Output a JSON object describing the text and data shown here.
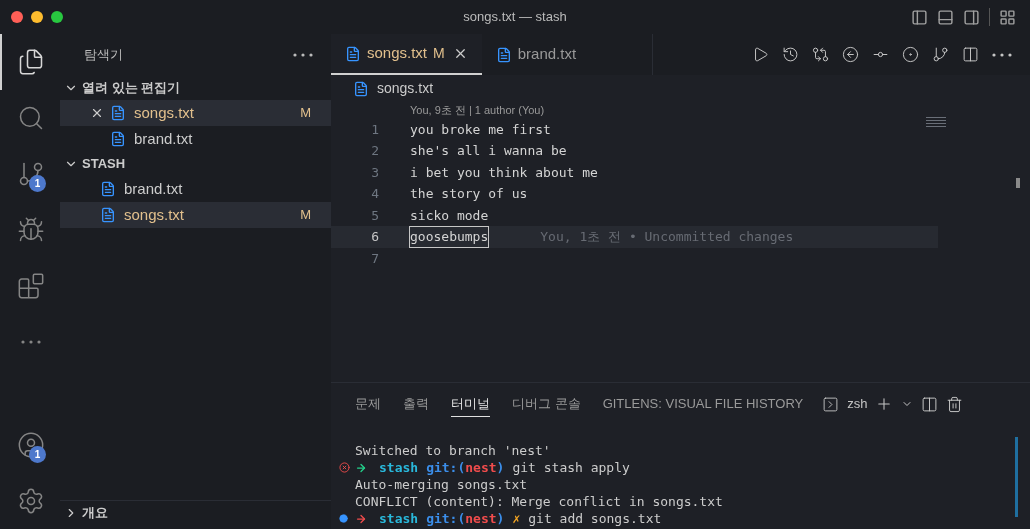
{
  "window": {
    "title": "songs.txt — stash"
  },
  "activity_bar": [
    {
      "kind": "files",
      "selected": true
    },
    {
      "kind": "search",
      "selected": false
    },
    {
      "kind": "source-control",
      "selected": false,
      "badge": "1"
    },
    {
      "kind": "debug",
      "selected": false
    },
    {
      "kind": "extensions",
      "selected": false
    },
    {
      "kind": "more",
      "selected": false
    }
  ],
  "activity_bar_bottom": [
    {
      "kind": "account",
      "badge": "1"
    },
    {
      "kind": "settings"
    }
  ],
  "sidebar": {
    "title": "탐색기",
    "sections": [
      {
        "title": "열려 있는 편집기",
        "expanded": true,
        "items": [
          {
            "name": "songs.txt",
            "status": "M",
            "selected": true,
            "closable": true
          },
          {
            "name": "brand.txt",
            "selected": false,
            "closable": false
          }
        ]
      },
      {
        "title": "STASH",
        "expanded": true,
        "items": [
          {
            "name": "brand.txt",
            "selected": false
          },
          {
            "name": "songs.txt",
            "status": "M",
            "selected": true
          }
        ]
      }
    ],
    "collapsed_sections": [
      {
        "title": "개요",
        "expanded": false
      }
    ]
  },
  "editor": {
    "tabs": [
      {
        "label": "songs.txt",
        "status": "M",
        "selected": true
      },
      {
        "label": "brand.txt",
        "selected": false
      }
    ],
    "breadcrumb": "songs.txt",
    "codelens": "You, 9초 전 | 1 author (You)",
    "lines": [
      {
        "number": "1",
        "text": "you broke me first",
        "current": false
      },
      {
        "number": "2",
        "text": "she's all i wanna be",
        "current": false
      },
      {
        "number": "3",
        "text": "i bet you think about me",
        "current": false
      },
      {
        "number": "4",
        "text": "the story of us",
        "current": false
      },
      {
        "number": "5",
        "text": "sicko mode",
        "current": false
      },
      {
        "number": "6",
        "text": "goosebumps",
        "current": true,
        "blame": "You, 1초 전 • Uncommitted changes"
      },
      {
        "number": "7",
        "current": false
      }
    ]
  },
  "panel": {
    "tabs": [
      {
        "label": "문제",
        "selected": false
      },
      {
        "label": "출력",
        "selected": false
      },
      {
        "label": "터미널",
        "selected": true
      },
      {
        "label": "디버그 콘솔",
        "selected": false
      },
      {
        "label": "GITLENS: VISUAL FILE HISTORY",
        "selected": false
      }
    ],
    "terminal_name": "zsh",
    "lines": [
      {
        "kind": "output",
        "text": "Switched to branch 'nest'"
      },
      {
        "kind": "prompt",
        "decoration_error": true,
        "arrow_error": false,
        "dir": "stash",
        "git": "git:(",
        "branch": "nest",
        "close": ")",
        "dirty": false,
        "command": "git stash apply"
      },
      {
        "kind": "output",
        "text": "Auto-merging songs.txt"
      },
      {
        "kind": "output",
        "text": "CONFLICT (content): Merge conflict in songs.txt"
      },
      {
        "kind": "prompt",
        "decoration_error": false,
        "arrow_error": true,
        "dir": "stash",
        "git": "git:(",
        "branch": "nest",
        "close": ")",
        "dirty": true,
        "dirty_mark": "✗",
        "command": "git add songs.txt"
      }
    ]
  }
}
